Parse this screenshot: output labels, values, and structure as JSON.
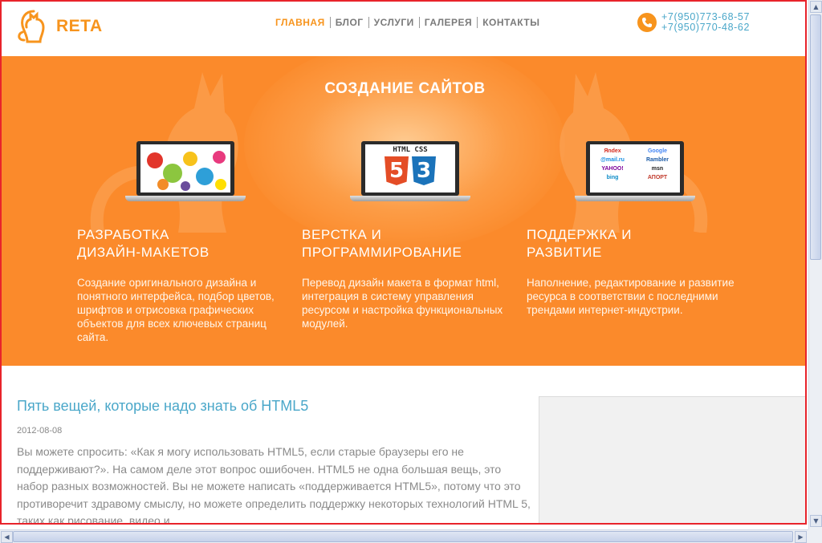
{
  "header": {
    "logo_text": "RETA",
    "nav": [
      {
        "label": "ГЛАВНАЯ",
        "active": true
      },
      {
        "label": "БЛОГ",
        "active": false
      },
      {
        "label": "УСЛУГИ",
        "active": false
      },
      {
        "label": "ГАЛЕРЕЯ",
        "active": false
      },
      {
        "label": "КОНТАКТЫ",
        "active": false
      }
    ],
    "phones": [
      "+7(950)773-68-57",
      "+7(950)770-48-62"
    ]
  },
  "hero": {
    "title": "СОЗДАНИЕ САЙТОВ",
    "columns": [
      {
        "title_line1": "РАЗРАБОТКА",
        "title_line2": "ДИЗАЙН-МАКЕТОВ",
        "text": "Создание оригинального дизайна и понятного интерфейса, подбор цветов, шрифтов и отрисовка графических объектов для всех ключевых страниц сайта."
      },
      {
        "title_line1": "ВЕРСТКА И",
        "title_line2": "ПРОГРАММИРОВАНИЕ",
        "text": "Перевод дизайн макета в формат html, интеграция в систему управления ресурсом и настройка функциональных модулей.",
        "screen_label": "HTML CSS",
        "badge_left": "5",
        "badge_right": "3"
      },
      {
        "title_line1": "ПОДДЕРЖКА И",
        "title_line2": "РАЗВИТИЕ",
        "text": "Наполнение, редактирование и развитие ресурса в соответствии с последними трендами интернет-индустрии.",
        "search_logos": [
          "Яndex",
          "Google",
          "@mail.ru",
          "Rambler",
          "YAHOO!",
          "msn",
          "bing",
          "АПОРТ"
        ]
      }
    ]
  },
  "article": {
    "title": "Пять вещей, которые надо знать об HTML5",
    "date": "2012-08-08",
    "text": "Вы можете спросить: «Как я могу использовать HTML5, если старые браузеры его не поддерживают?». На самом деле этот вопрос ошибочен. HTML5 не одна большая вещь, это набор разных возможностей. Вы не можете написать «поддерживается HTML5», потому что это противоречит здравому смыслу, но можете определить поддержку некоторых технологий HTML 5, таких как рисование, видео и"
  },
  "colors": {
    "accent": "#f7941d",
    "hero_bg": "#fb8a2b",
    "link": "#4aa7c9",
    "frame": "#e8232b"
  },
  "icons": [
    "cat-logo-icon",
    "phone-icon",
    "laptop-icon",
    "scroll-up-icon",
    "scroll-down-icon",
    "scroll-left-icon",
    "scroll-right-icon"
  ]
}
